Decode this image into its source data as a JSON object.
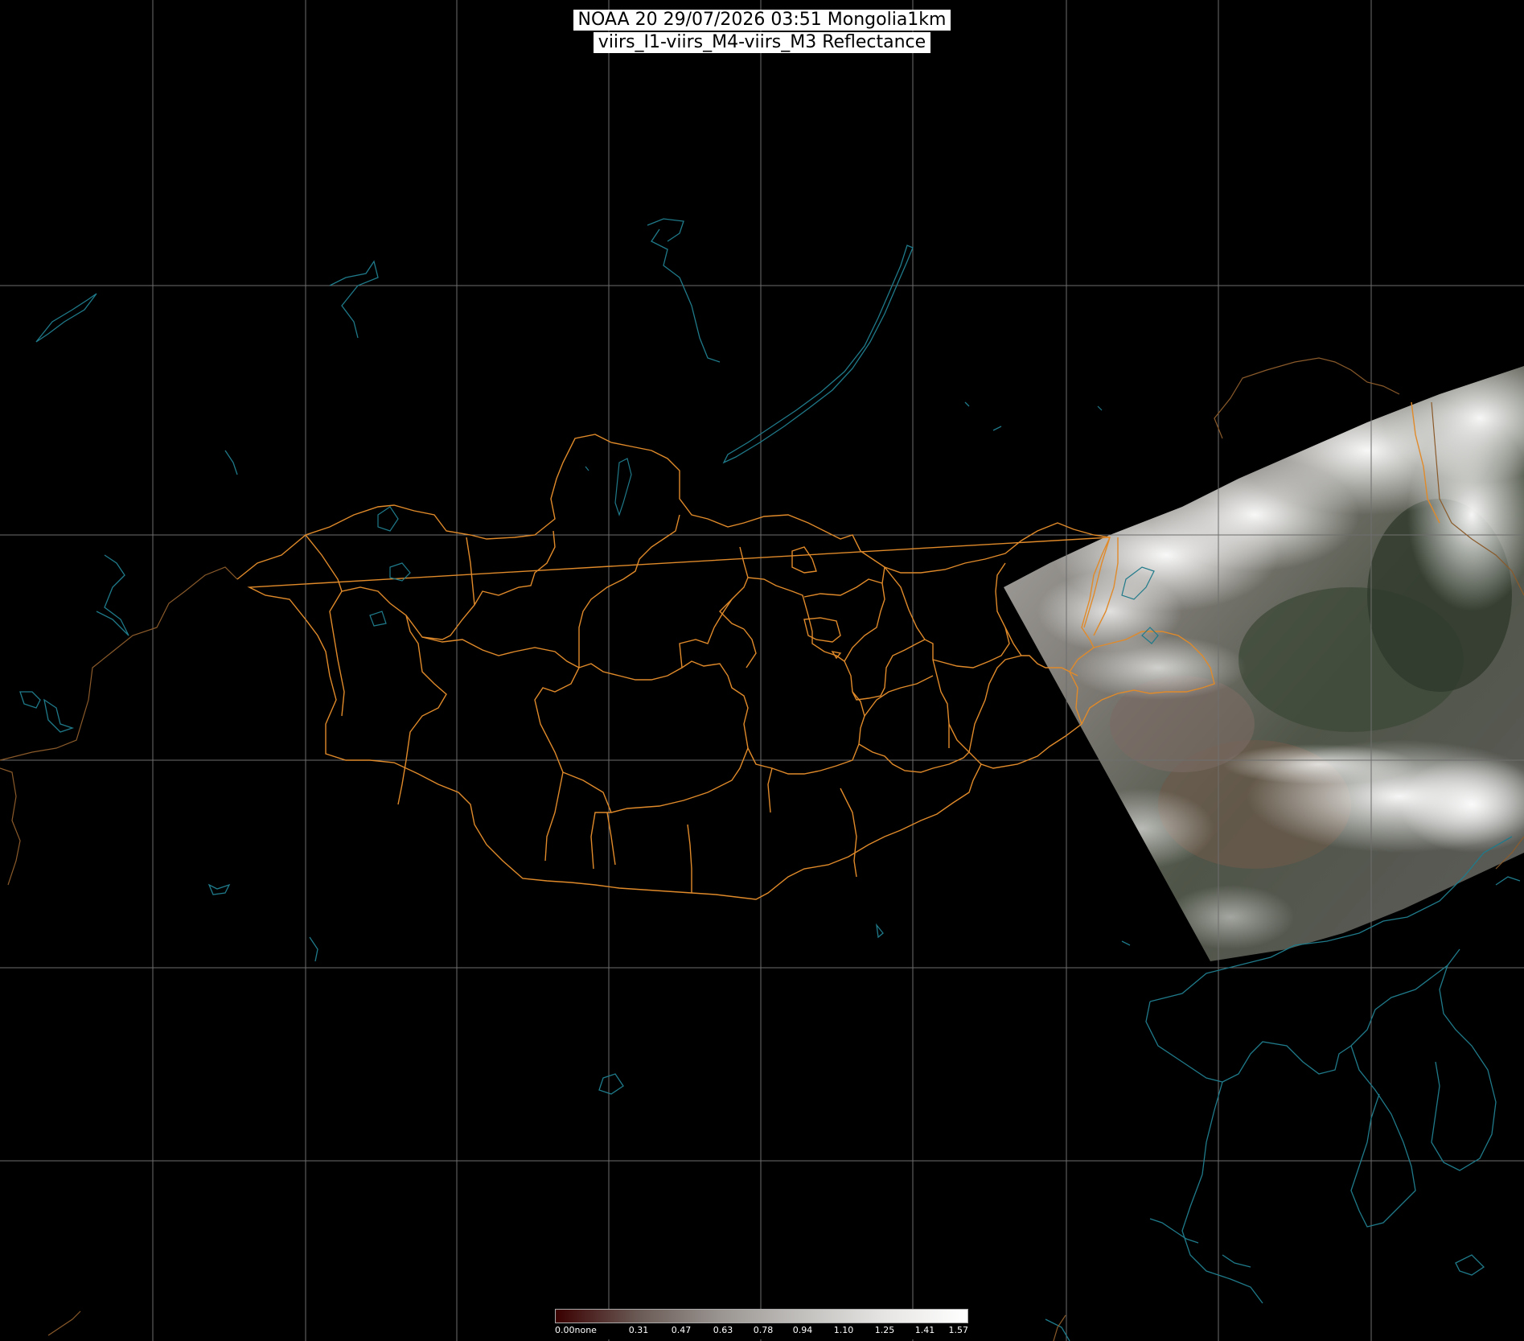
{
  "title": {
    "line1": "NOAA 20 29/07/2026 03:51 Mongolia1km",
    "line2": "viirs_I1-viirs_M4-viirs_M3 Reflectance"
  },
  "colorbar": {
    "ticks": [
      "0.00none",
      "0.31",
      "0.47",
      "0.63",
      "0.78",
      "0.94",
      "1.10",
      "1.25",
      "1.41",
      "1.57"
    ],
    "colors": [
      "#3a0000",
      "#6a5a55",
      "#9a9591",
      "#c2c0bd",
      "#e6e5e3",
      "#ffffff"
    ]
  },
  "colors": {
    "background": "#000000",
    "grid": "#6e6e6e",
    "admin_border": "#e08a2a",
    "coast": "#1f7a8a",
    "national_border": "#8a5a2a"
  }
}
